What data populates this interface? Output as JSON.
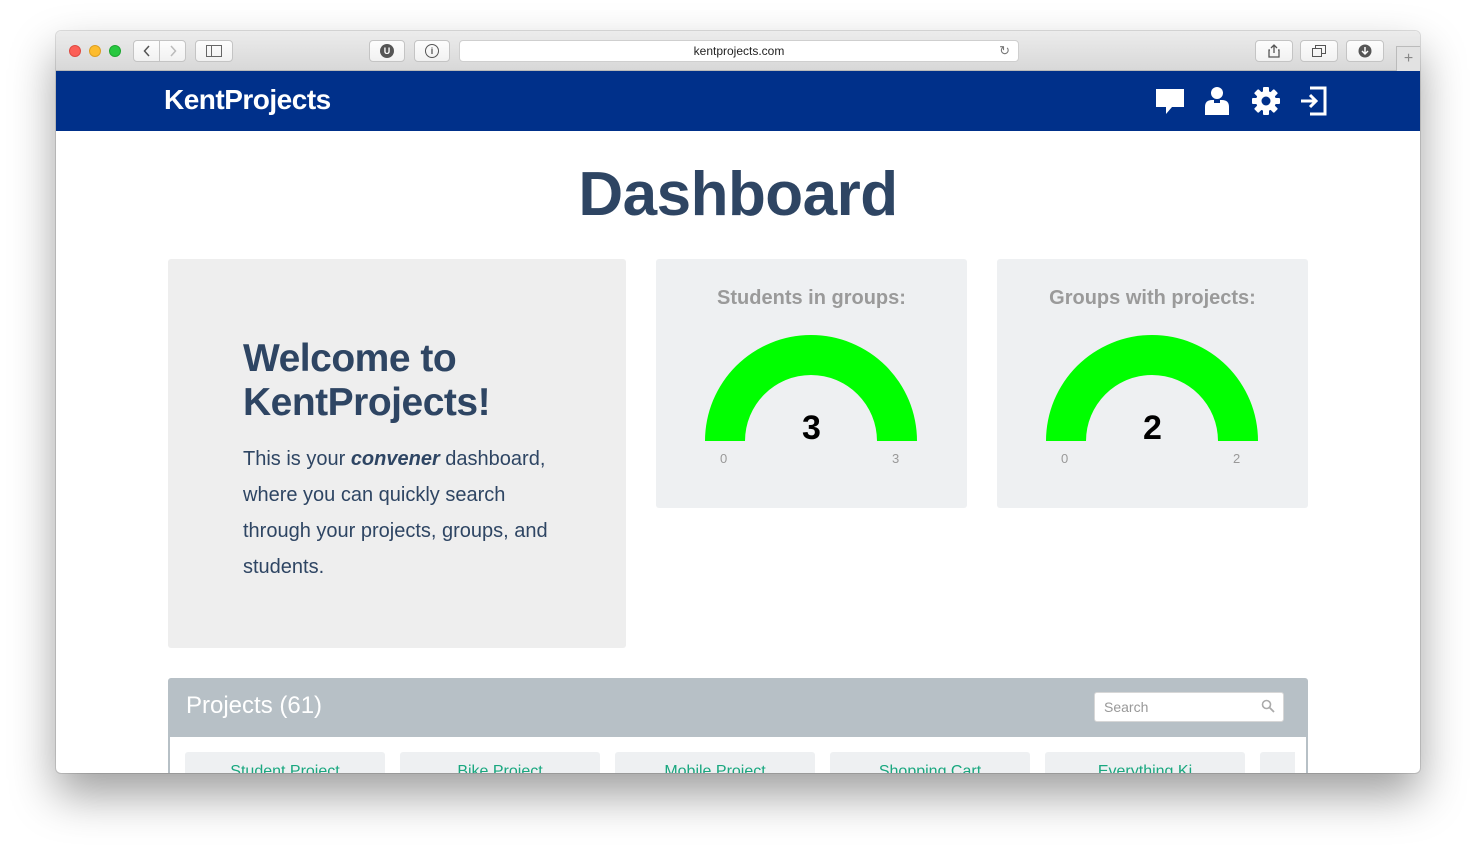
{
  "browser": {
    "url": "kentprojects.com",
    "ext1_label": "U",
    "ext2_label": "i"
  },
  "header": {
    "brand": "KentProjects",
    "icons": [
      "chat-icon",
      "user-icon",
      "gear-icon",
      "logout-icon"
    ]
  },
  "page": {
    "title": "Dashboard"
  },
  "welcome": {
    "title": "Welcome to KentProjects!",
    "text_before": "This is your ",
    "text_emphasis": "convener",
    "text_after": " dashboard, where you can quickly search through your projects, groups, and students."
  },
  "stats": [
    {
      "label": "Students in groups:",
      "value": "3",
      "min": "0",
      "max": "3",
      "fraction": 1.0,
      "color": "#00ff00"
    },
    {
      "label": "Groups with projects:",
      "value": "2",
      "min": "0",
      "max": "2",
      "fraction": 1.0,
      "color": "#00ff00"
    }
  ],
  "projects": {
    "title": "Projects (61)",
    "search_placeholder": "Search",
    "tiles": [
      "Student Project",
      "Bike Project",
      "Mobile Project",
      "Shopping Cart",
      "Everything Ki",
      ""
    ]
  },
  "colors": {
    "header_bg": "#00308a",
    "title": "#2e4563",
    "gauge_fill": "#00ff00",
    "tile_text": "#19a77f"
  }
}
